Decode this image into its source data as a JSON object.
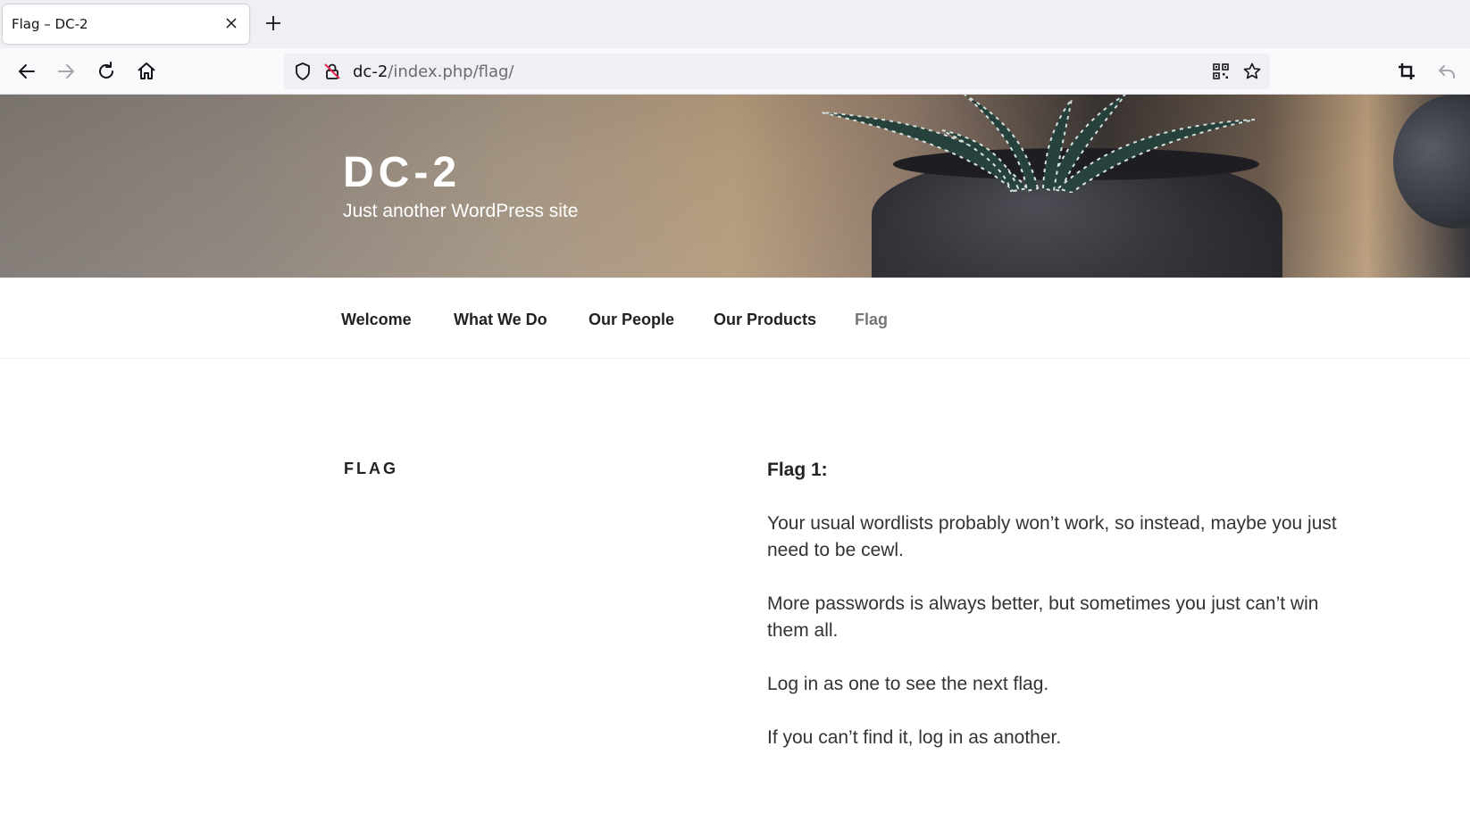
{
  "browser": {
    "tab_title": "Flag – DC-2",
    "url_host": "dc-2",
    "url_path": "/index.php/flag/"
  },
  "icons": {
    "back": "arrow-left-icon",
    "forward": "arrow-right-icon",
    "reload": "reload-icon",
    "home": "home-icon",
    "tracking": "shield-icon",
    "insecure": "insecure-lock-icon",
    "qr": "qr-code-icon",
    "bookmark": "star-icon",
    "crop": "crop-icon",
    "undo": "undo-icon"
  },
  "site": {
    "title": "DC-2",
    "description": "Just another WordPress site"
  },
  "menu": [
    {
      "label": "Welcome"
    },
    {
      "label": "What We Do"
    },
    {
      "label": "Our People"
    },
    {
      "label": "Our Products"
    },
    {
      "label": "Flag",
      "current": true
    }
  ],
  "page": {
    "heading": "FLAG",
    "content_title": "Flag 1:",
    "paragraphs": [
      "Your usual wordlists probably won’t work, so instead, maybe you just need to be cewl.",
      "More passwords is always better, but sometimes you just can’t win them all.",
      "Log in as one to see the next flag.",
      "If you can’t find it, log in as another."
    ]
  },
  "colors": {
    "text": "#333333",
    "menu_current": "#767676",
    "chrome_bg": "#f0f0f4"
  }
}
